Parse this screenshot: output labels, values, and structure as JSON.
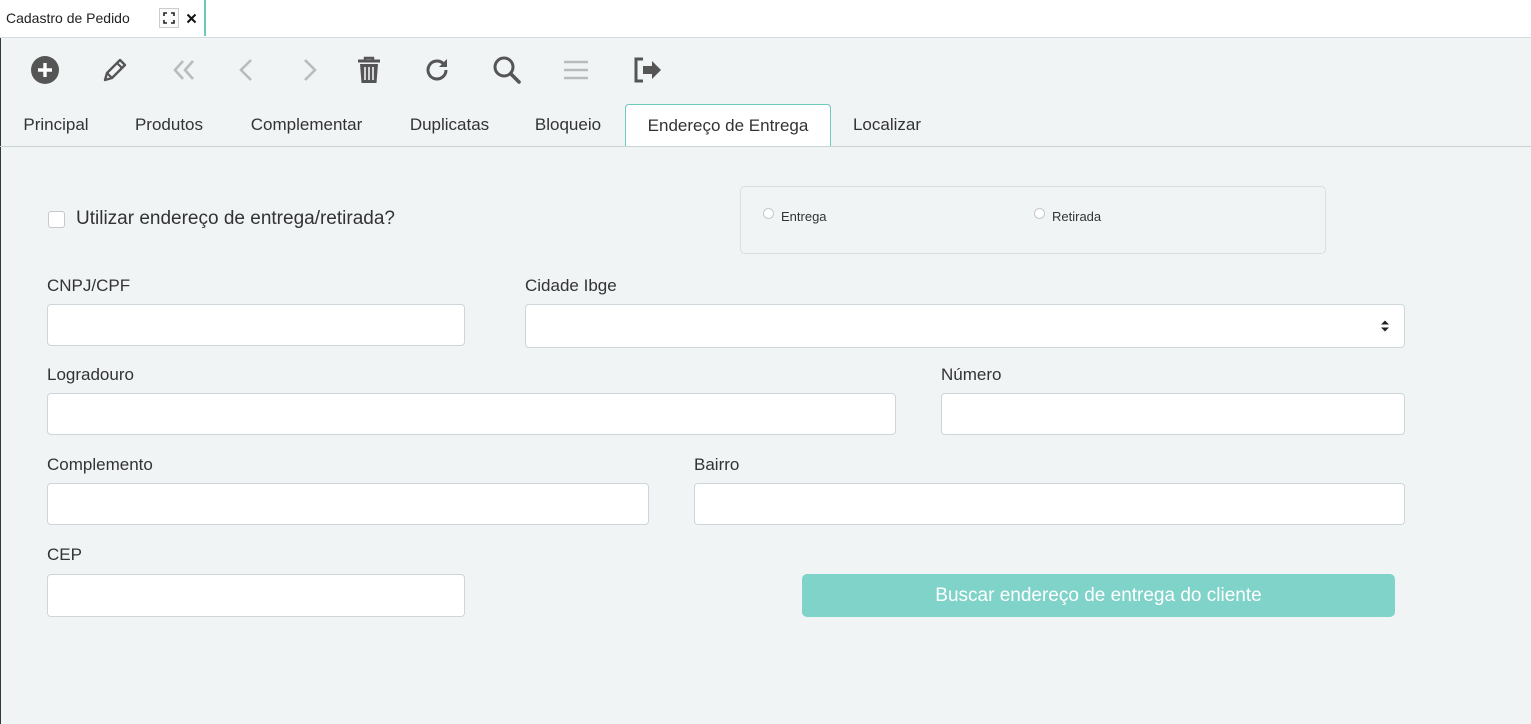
{
  "window_tab": {
    "title": "Cadastro de Pedido"
  },
  "toolbar": {
    "icons": [
      "plus-circle-icon",
      "pencil-icon",
      "double-chevron-left-icon",
      "chevron-left-icon",
      "chevron-right-icon",
      "trash-icon",
      "refresh-icon",
      "search-icon",
      "list-icon",
      "sign-out-icon"
    ]
  },
  "tabs": [
    {
      "label": "Principal"
    },
    {
      "label": "Produtos"
    },
    {
      "label": "Complementar"
    },
    {
      "label": "Duplicatas"
    },
    {
      "label": "Bloqueio"
    },
    {
      "label": "Endereço de Entrega"
    },
    {
      "label": "Localizar"
    }
  ],
  "active_tab": "Endereço de Entrega",
  "form": {
    "use_address_label": "Utilizar endereço de entrega/retirada?",
    "use_address_checked": false,
    "radio_entrega": "Entrega",
    "radio_retirada": "Retirada",
    "cnpj_label": "CNPJ/CPF",
    "cnpj_value": "",
    "cidade_label": "Cidade Ibge",
    "cidade_value": "",
    "logradouro_label": "Logradouro",
    "logradouro_value": "",
    "numero_label": "Número",
    "numero_value": "",
    "complemento_label": "Complemento",
    "complemento_value": "",
    "bairro_label": "Bairro",
    "bairro_value": "",
    "cep_label": "CEP",
    "cep_value": "",
    "buscar_button": "Buscar endereço de entrega do cliente"
  },
  "colors": {
    "accent": "#6ec9bd",
    "button": "#7fd3c9",
    "background": "#f0f4f5",
    "icon": "#555555",
    "icon_disabled": "#b8bcbe"
  }
}
